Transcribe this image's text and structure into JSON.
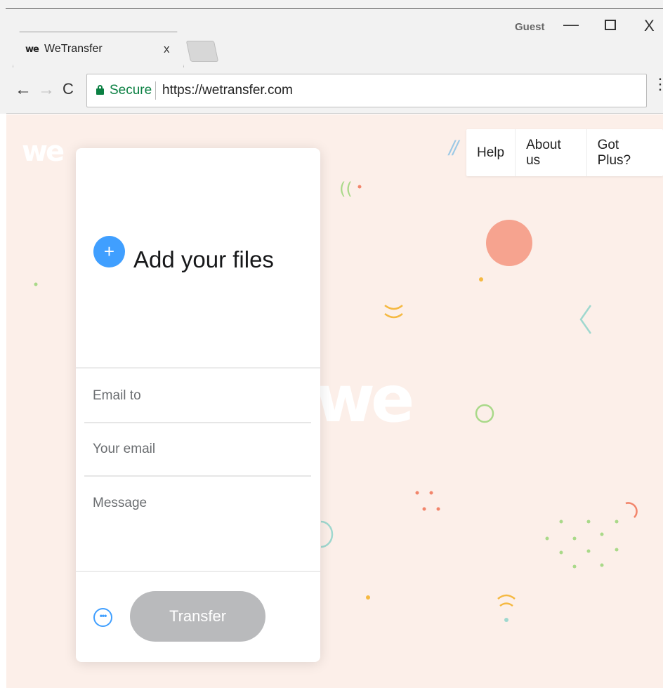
{
  "window": {
    "user": "Guest",
    "minimize_glyph": "—",
    "close_glyph": "X"
  },
  "tab": {
    "logo": "we",
    "title": "WeTransfer",
    "close_glyph": "x"
  },
  "toolbar": {
    "secure_label": "Secure",
    "url": "https://wetransfer.com"
  },
  "page": {
    "logo": "we",
    "nav": [
      "Help",
      "About us",
      "Got Plus?"
    ],
    "upload_card": {
      "add_files_label": "Add your files",
      "email_to_placeholder": "Email to",
      "your_email_placeholder": "Your email",
      "message_placeholder": "Message",
      "more_glyph": "•••",
      "transfer_label": "Transfer"
    }
  },
  "colors": {
    "background": "#fcefe9",
    "accent_blue": "#409fff",
    "secure_green": "#0b8043",
    "disabled_button": "#b9babc"
  }
}
